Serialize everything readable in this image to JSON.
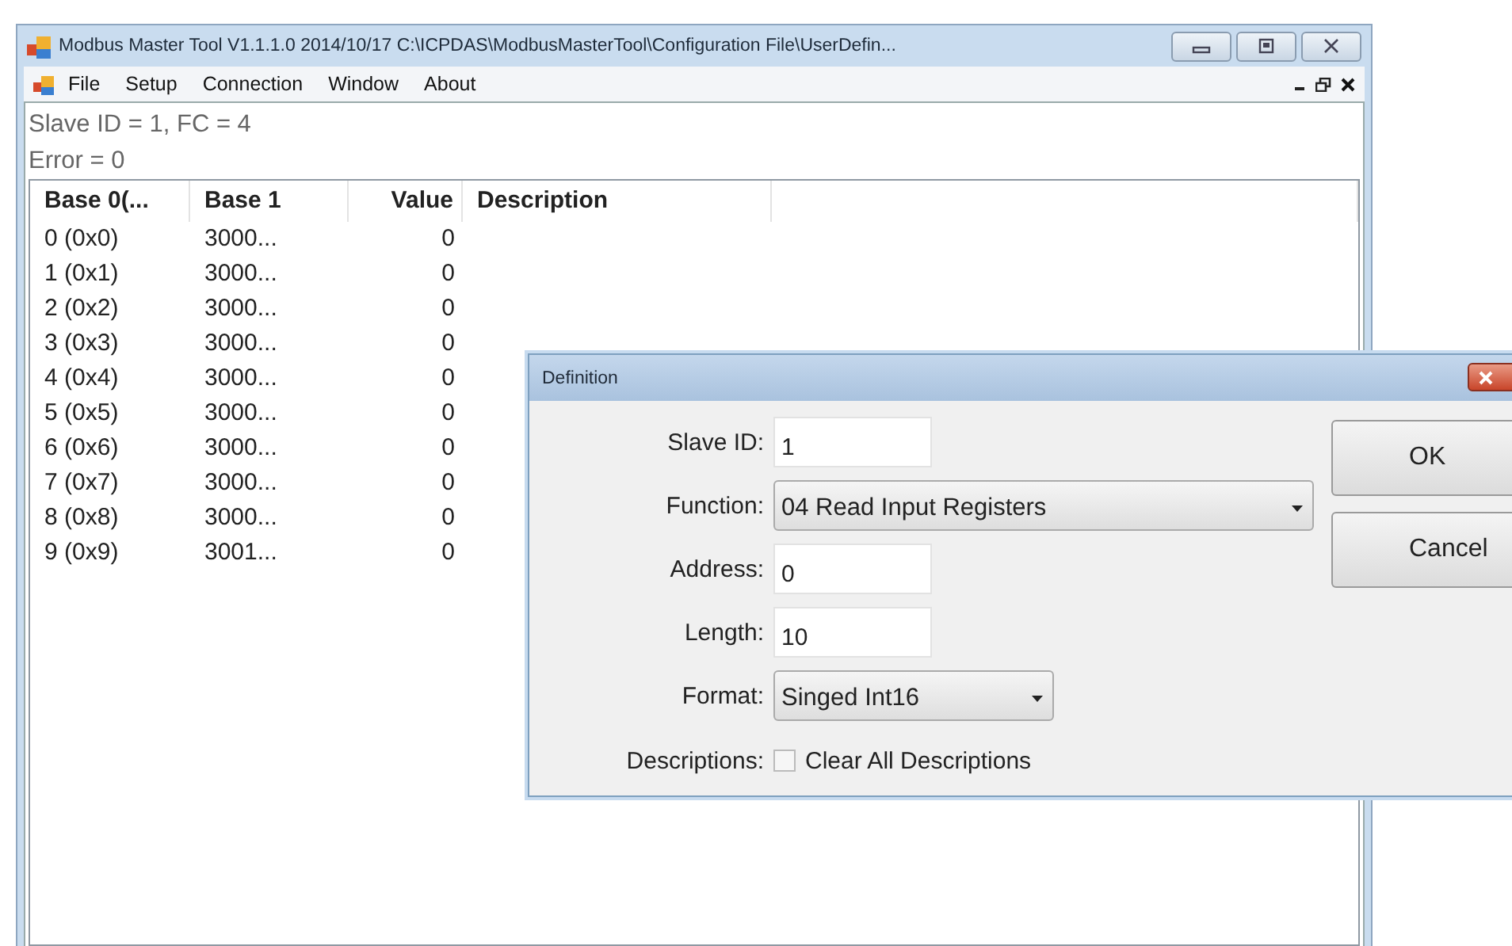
{
  "window": {
    "title": "Modbus Master Tool V1.1.1.0  2014/10/17  C:\\ICPDAS\\ModbusMasterTool\\Configuration File\\UserDefin..."
  },
  "menu": {
    "items": [
      "File",
      "Setup",
      "Connection",
      "Window",
      "About"
    ]
  },
  "status_lines": [
    "Slave ID = 1, FC = 4",
    "Error = 0"
  ],
  "table": {
    "columns": [
      "Base 0(...",
      "Base 1",
      "Value",
      "Description"
    ],
    "rows": [
      [
        "0 (0x0)",
        "3000...",
        "0"
      ],
      [
        "1 (0x1)",
        "3000...",
        "0"
      ],
      [
        "2 (0x2)",
        "3000...",
        "0"
      ],
      [
        "3 (0x3)",
        "3000...",
        "0"
      ],
      [
        "4 (0x4)",
        "3000...",
        "0"
      ],
      [
        "5 (0x5)",
        "3000...",
        "0"
      ],
      [
        "6 (0x6)",
        "3000...",
        "0"
      ],
      [
        "7 (0x7)",
        "3000...",
        "0"
      ],
      [
        "8 (0x8)",
        "3000...",
        "0"
      ],
      [
        "9 (0x9)",
        "3001...",
        "0"
      ]
    ]
  },
  "dialog": {
    "title": "Definition",
    "fields": [
      {
        "kind": "input",
        "label": "Slave ID:",
        "value": "1"
      },
      {
        "kind": "select",
        "label": "Function:",
        "value": "04 Read Input Registers"
      },
      {
        "kind": "input",
        "label": "Address:",
        "value": "0"
      },
      {
        "kind": "input",
        "label": "Length:",
        "value": "10"
      },
      {
        "kind": "select",
        "label": "Format:",
        "value": "Singed Int16"
      },
      {
        "kind": "checkbox",
        "label": "Descriptions:",
        "text": "Clear All Descriptions",
        "checked": false
      }
    ],
    "buttons": [
      "OK",
      "Cancel"
    ]
  }
}
